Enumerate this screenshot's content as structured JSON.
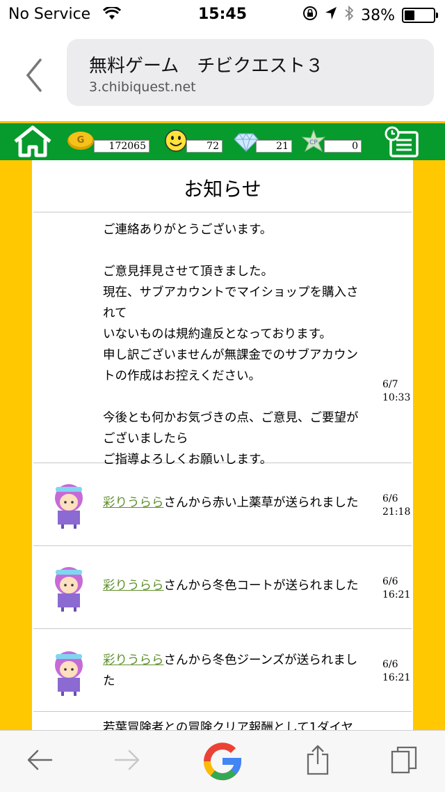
{
  "status": {
    "carrier": "No Service",
    "time": "15:45",
    "battery": "38%",
    "battery_level": 0.38
  },
  "browser": {
    "title": "無料ゲーム　チビクエスト３",
    "host": "3.chibiquest.net"
  },
  "game_bar": {
    "gold": "172065",
    "smile": "72",
    "diamond": "21",
    "cp": "0"
  },
  "notices": {
    "heading": "お知らせ",
    "items": [
      {
        "paragraphs": [
          [
            "ご連絡ありがとうございます。"
          ],
          [
            "ご意見拝見させて頂きました。",
            "現在、サブアカウントでマイショップを購入さ",
            "れて",
            "いないものは規約違反となっております。",
            "申し訳ございませんが無課金でのサブアカウン",
            "トの作成はお控えください。"
          ],
          [
            "今後とも何かお気づきの点、ご意見、ご要望が",
            "ございましたら",
            "ご指導よろしくお願いします。"
          ]
        ],
        "date": "6/7",
        "time": "10:33"
      },
      {
        "sender": "彩りうらら",
        "text": "さんから赤い上薬草が送られました",
        "date": "6/6",
        "time": "21:18"
      },
      {
        "sender": "彩りうらら",
        "text": "さんから冬色コートが送られました",
        "date": "6/6",
        "time": "16:21"
      },
      {
        "sender": "彩りうらら",
        "text_line1": "さんから冬色ジーンズが送られまし",
        "text_line2": "た",
        "date": "6/6",
        "time": "16:21"
      },
      {
        "text": "若葉冒険者との冒険クリア報酬として1ダイヤ"
      }
    ]
  }
}
